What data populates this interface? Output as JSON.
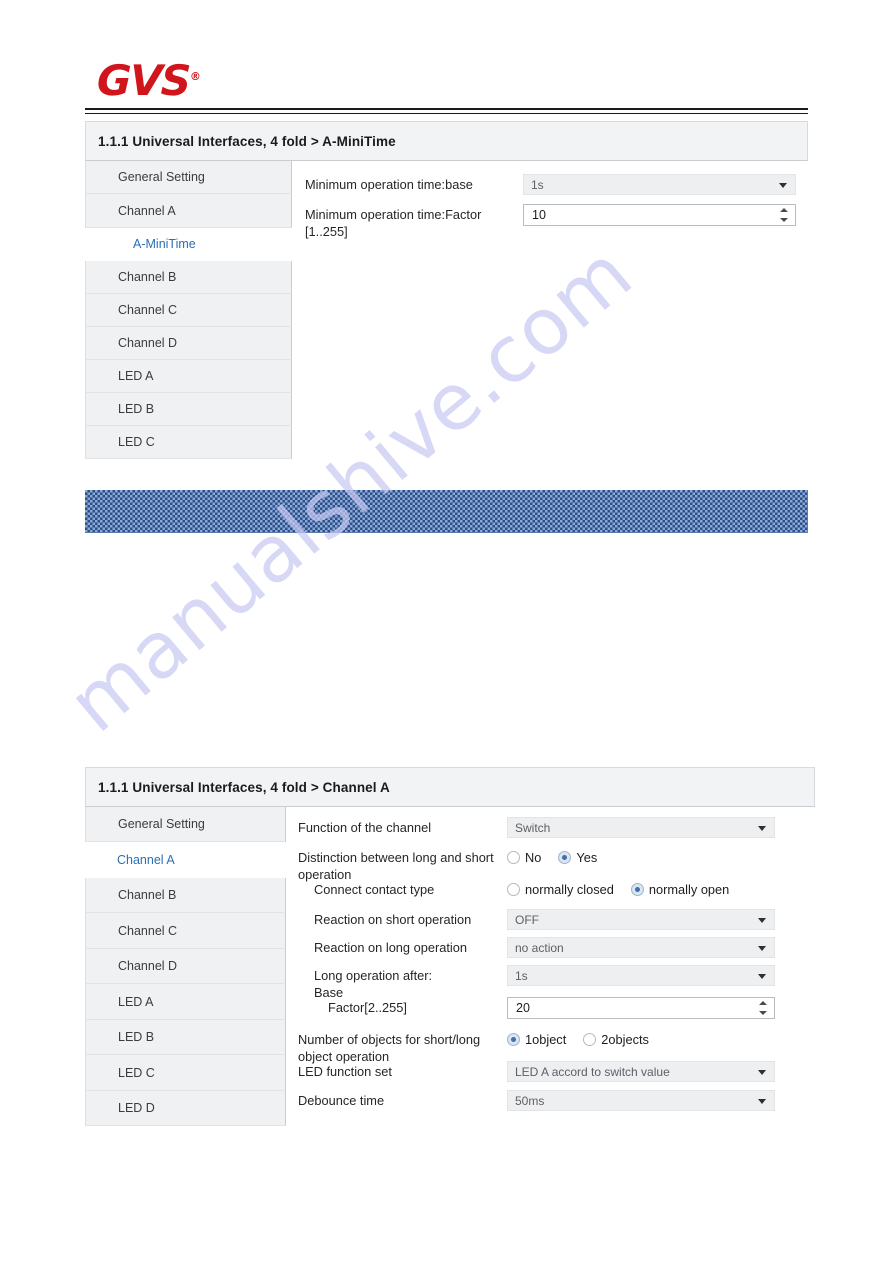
{
  "brand": {
    "logo_text": "GVS",
    "logo_mark": "®",
    "logo_color": "#d0161c"
  },
  "watermark": {
    "text": "manualshive.com",
    "color": "#c9caf2"
  },
  "redaction_band": {
    "color": "#8ba9d4",
    "pattern_color": "#2c4f8a"
  },
  "panels": [
    {
      "title": "1.1.1 Universal Interfaces, 4 fold > A-MiniTime",
      "sidebar": [
        {
          "label": "General Setting",
          "level": 0,
          "selected": false
        },
        {
          "label": "Channel A",
          "level": 0,
          "selected": false
        },
        {
          "label": "A-MiniTime",
          "level": 1,
          "selected": true
        },
        {
          "label": "Channel B",
          "level": 0,
          "selected": false
        },
        {
          "label": "Channel C",
          "level": 0,
          "selected": false
        },
        {
          "label": "Channel D",
          "level": 0,
          "selected": false
        },
        {
          "label": "LED A",
          "level": 0,
          "selected": false
        },
        {
          "label": "LED B",
          "level": 0,
          "selected": false
        },
        {
          "label": "LED C",
          "level": 0,
          "selected": false
        }
      ],
      "rows": [
        {
          "label": "Minimum operation time:base",
          "control": "select",
          "value": "1s",
          "indent": false
        },
        {
          "label": "Minimum operation time:Factor\n[1..255]",
          "control": "spinner",
          "value": "10",
          "indent": false
        }
      ]
    },
    {
      "title": "1.1.1 Universal Interfaces, 4 fold > Channel A",
      "sidebar": [
        {
          "label": "General Setting",
          "level": 0,
          "selected": false
        },
        {
          "label": "Channel A",
          "level": 0,
          "selected": true
        },
        {
          "label": "Channel B",
          "level": 0,
          "selected": false
        },
        {
          "label": "Channel C",
          "level": 0,
          "selected": false
        },
        {
          "label": "Channel D",
          "level": 0,
          "selected": false
        },
        {
          "label": "LED A",
          "level": 0,
          "selected": false
        },
        {
          "label": "LED B",
          "level": 0,
          "selected": false
        },
        {
          "label": "LED C",
          "level": 0,
          "selected": false
        },
        {
          "label": "LED D",
          "level": 0,
          "selected": false
        }
      ],
      "rows": [
        {
          "label": "Function of the channel",
          "control": "select",
          "value": "Switch",
          "indent": false
        },
        {
          "label": "Distinction between long and short operation",
          "control": "radio",
          "options": [
            {
              "label": "No",
              "checked": false
            },
            {
              "label": "Yes",
              "checked": true
            }
          ],
          "indent": false
        },
        {
          "label": "Connect contact type",
          "control": "radio",
          "options": [
            {
              "label": "normally closed",
              "checked": false
            },
            {
              "label": "normally open",
              "checked": true
            }
          ],
          "indent": true
        },
        {
          "label": "Reaction on short operation",
          "control": "select",
          "value": "OFF",
          "indent": true
        },
        {
          "label": "Reaction on long operation",
          "control": "select",
          "value": "no action",
          "indent": true
        },
        {
          "label": "Long operation after:\n    Base",
          "control": "select",
          "value": "1s",
          "indent": true
        },
        {
          "label": "Factor[2..255]",
          "control": "spinner",
          "value": "20",
          "indent": true,
          "extra_indent": true
        },
        {
          "label": "Number of objects for short/long object operation",
          "control": "radio",
          "options": [
            {
              "label": "1object",
              "checked": true
            },
            {
              "label": "2objects",
              "checked": false
            }
          ],
          "indent": false
        },
        {
          "label": "LED function set",
          "control": "select",
          "value": "LED A accord to switch value",
          "indent": false
        },
        {
          "label": "Debounce time",
          "control": "select",
          "value": "50ms",
          "indent": false
        }
      ]
    }
  ]
}
